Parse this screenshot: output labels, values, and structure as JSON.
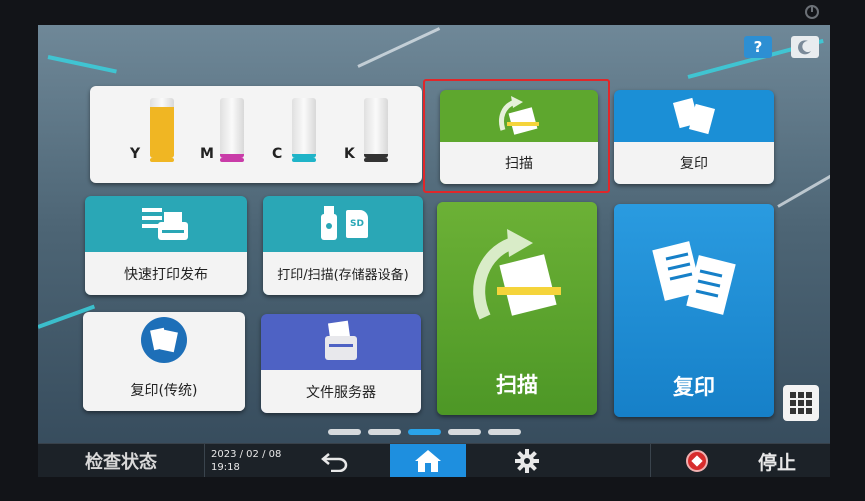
{
  "colors": {
    "green_tile": "#5ea72e",
    "blue_tile": "#1b8fd6",
    "teal_header": "#2aa7b6",
    "highlight": "#e0272a",
    "active_tab": "#1e8fdf",
    "stop_icon": "#d72c2c"
  },
  "topbar": {
    "help_label": "?",
    "help_icon": "question-icon",
    "energy_icon": "moon-icon"
  },
  "toner": {
    "items": [
      {
        "letter": "Y",
        "color": "#f0b623",
        "level": 0.85
      },
      {
        "letter": "M",
        "color": "#c93ca8",
        "level": 0.06
      },
      {
        "letter": "C",
        "color": "#1fb4c8",
        "level": 0.06
      },
      {
        "letter": "K",
        "color": "#333333",
        "level": 0.06
      }
    ]
  },
  "tiles": {
    "quick_print": "快速打印发布",
    "print_scan_storage": "打印/扫描(存储器设备)",
    "copy_classic": "复印(传统)",
    "file_server": "文件服务器",
    "scan_small": "扫描",
    "copy_small": "复印",
    "scan_big": "扫描",
    "copy_big": "复印",
    "sd_label": "SD"
  },
  "bottombar": {
    "check_status": "检查状态",
    "date": "2023 / 02 / 08",
    "time": "19:18",
    "back_icon": "back-arrow-icon",
    "home_icon": "home-icon",
    "settings_icon": "gear-icon",
    "stop_label": "停止"
  },
  "pager": {
    "pages": 5,
    "active": 3
  }
}
